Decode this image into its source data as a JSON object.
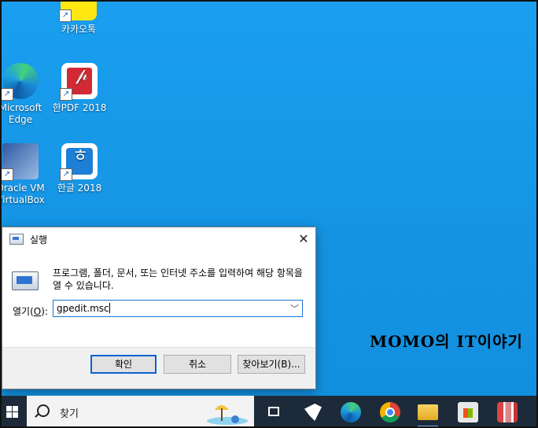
{
  "desktop": {
    "icons": [
      {
        "label": "카카오톡"
      },
      {
        "label": "Microsoft Edge"
      },
      {
        "label": "한PDF 2018"
      },
      {
        "label": "Oracle VM VirtualBox"
      },
      {
        "label": "한글 2018"
      }
    ],
    "watermark": "MOMO의 IT이야기"
  },
  "run_dialog": {
    "title": "실행",
    "description": "프로그램, 폴더, 문서, 또는 인터넷 주소를 입력하여 해당 항목을 열 수 있습니다.",
    "open_label_prefix": "열기(",
    "open_label_key": "O",
    "open_label_suffix": "):",
    "command_value": "gpedit.msc",
    "ok_label": "확인",
    "cancel_label": "취소",
    "browse_label": "찾아보기(B)..."
  },
  "taskbar": {
    "search_placeholder": "찾기"
  }
}
